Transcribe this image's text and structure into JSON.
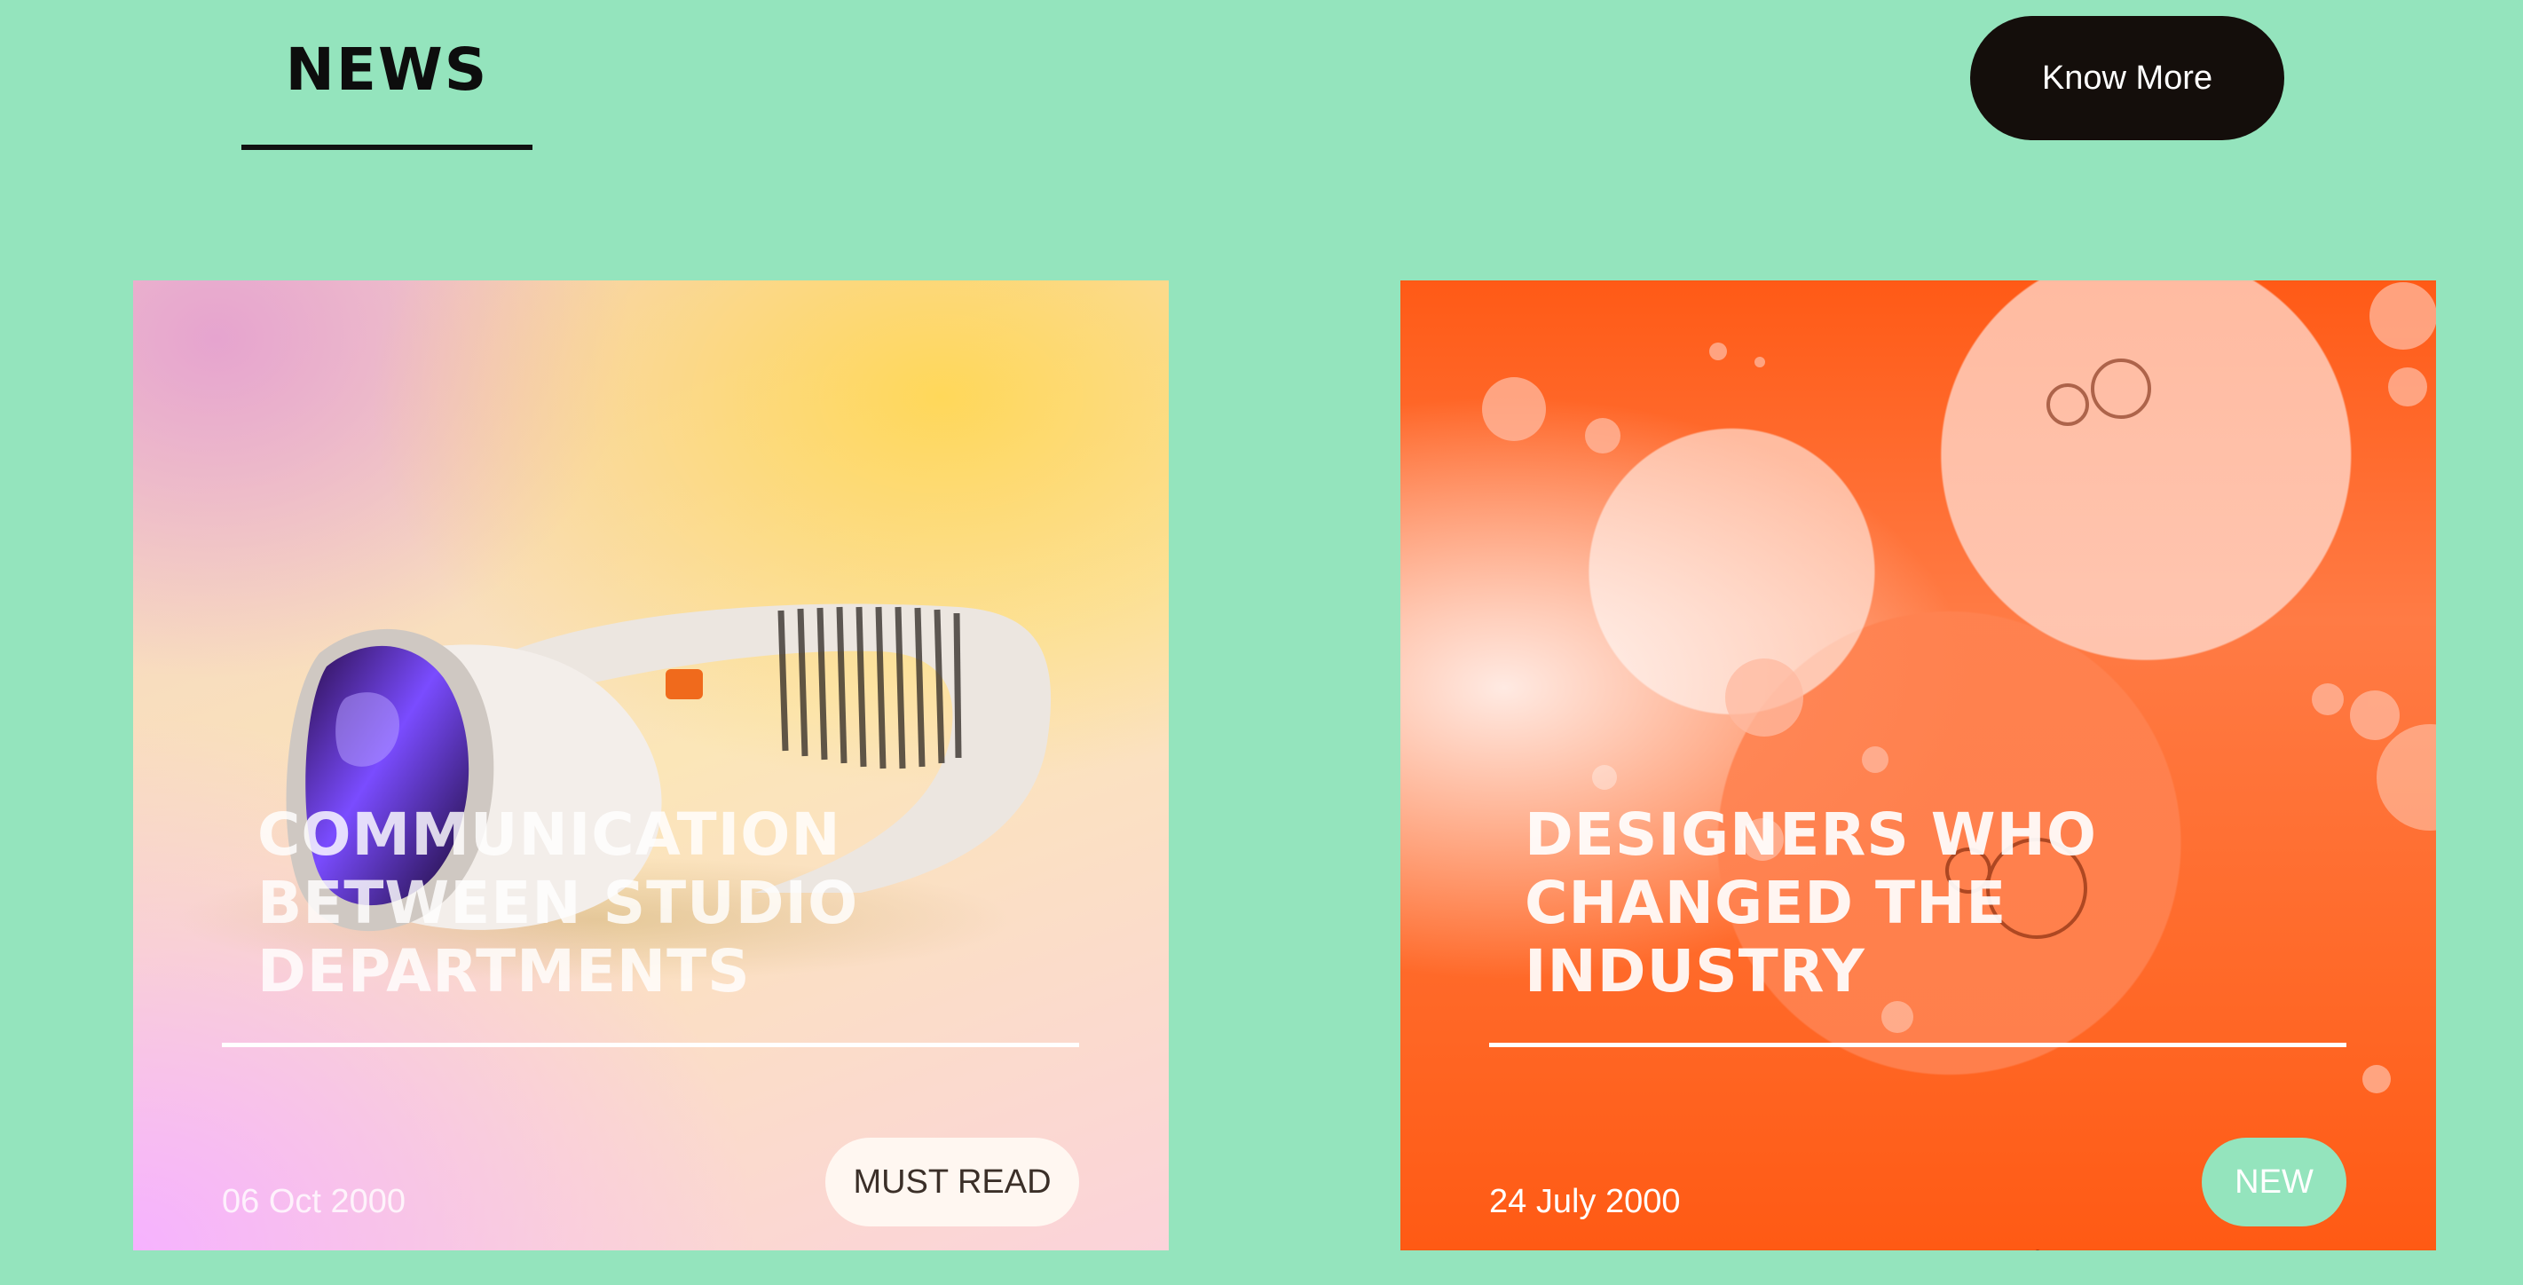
{
  "section": {
    "title": "NEWS"
  },
  "header": {
    "know_more_label": "Know More"
  },
  "colors": {
    "background": "#94e4bd",
    "button_dark": "#140e0b",
    "accent_mint": "#94e4bd",
    "card_orange": "#ff5a16"
  },
  "cards": [
    {
      "title": "COMMUNICATION BETWEEN STUDIO DEPARTMENTS",
      "date": "06 Oct 2000",
      "tag": "MUST READ",
      "image": "vr-headset-illustration"
    },
    {
      "title": "DESIGNERS WHO CHANGED THE INDUSTRY",
      "date": "24 July 2000",
      "tag": "NEW",
      "image": "orange-bubbles-illustration"
    }
  ]
}
